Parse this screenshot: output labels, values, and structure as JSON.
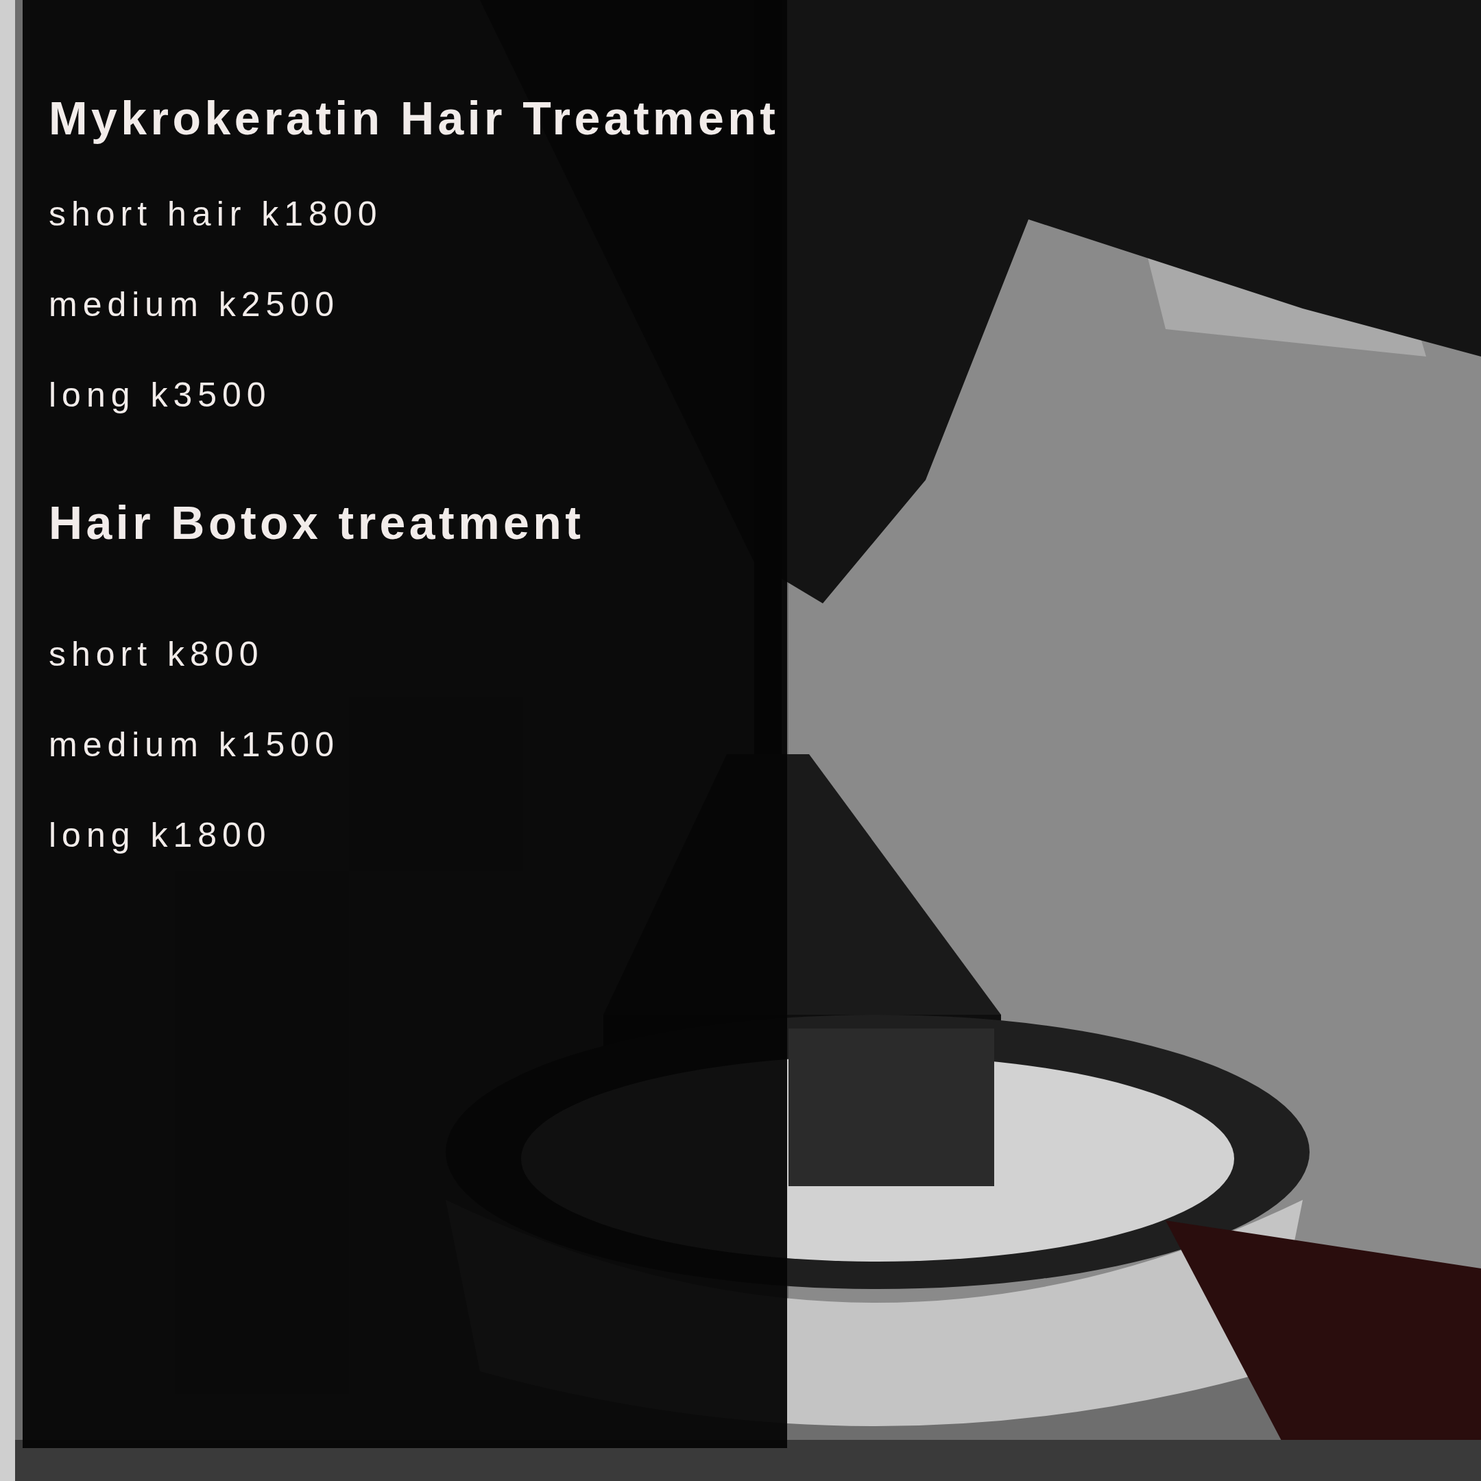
{
  "sections": [
    {
      "title": "Mykrokeratin Hair Treatment",
      "items": [
        "short hair k1800",
        "medium k2500",
        "long k3500"
      ]
    },
    {
      "title": "Hair Botox treatment",
      "items": [
        "short k800",
        "medium k1500",
        "long k1800"
      ]
    }
  ]
}
